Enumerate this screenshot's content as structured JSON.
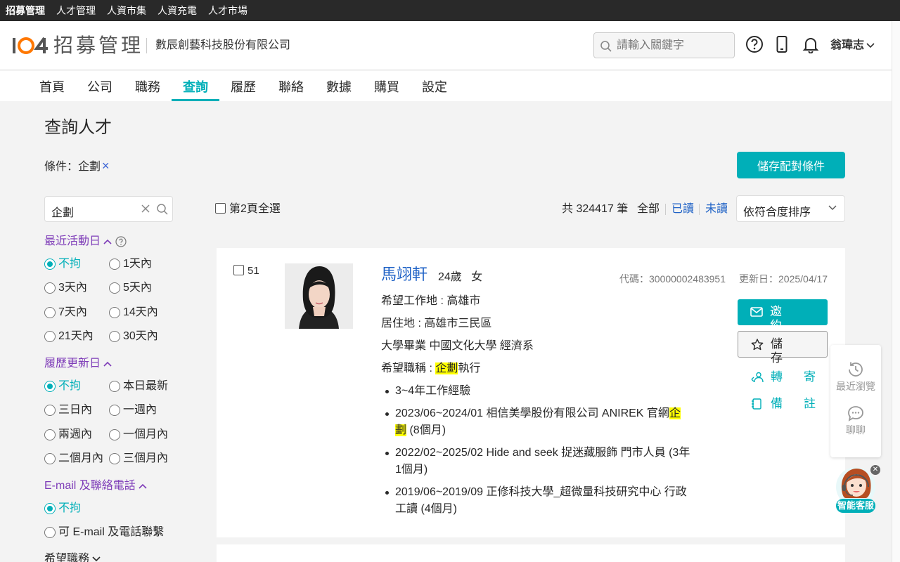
{
  "topbar": {
    "items": [
      "招募管理",
      "人才管理",
      "人資市集",
      "人資充電",
      "人才市場"
    ]
  },
  "header": {
    "brand": "招募管理",
    "company": "數辰創藝科技股份有限公司",
    "search_placeholder": "請輸入關鍵字",
    "user": "翁瑋志"
  },
  "nav": {
    "tabs": [
      "首頁",
      "公司",
      "職務",
      "查詢",
      "履歷",
      "聯絡",
      "數據",
      "購買",
      "設定"
    ],
    "active": "查詢"
  },
  "page": {
    "title": "查詢人才",
    "condition_label": "條件：企劃",
    "condition_remove": "×",
    "save_button": "儲存配對條件"
  },
  "sidebar": {
    "keyword": "企劃",
    "filters": [
      {
        "title": "最近活動日",
        "options": [
          "不拘",
          "1天內",
          "3天內",
          "5天內",
          "7天內",
          "14天內",
          "21天內",
          "30天內"
        ],
        "selected": "不拘"
      },
      {
        "title": "履歷更新日",
        "options": [
          "不拘",
          "本日最新",
          "三日內",
          "一週內",
          "兩週內",
          "一個月內",
          "二個月內",
          "三個月內"
        ],
        "selected": "不拘"
      },
      {
        "title": "E-mail 及聯絡電話",
        "options": [
          "不拘",
          "可 E-mail 及電話聯繫"
        ],
        "selected": "不拘"
      },
      {
        "title": "希望職務"
      }
    ]
  },
  "list": {
    "select_all": "第2頁全選",
    "total": "共 324417 筆",
    "filter_all": "全部",
    "filter_read": "已讀",
    "filter_unread": "未讀",
    "sort": "依符合度排序"
  },
  "card": {
    "index": "51",
    "name": "馬翊軒",
    "age": "24歲",
    "gender": "女",
    "code": "代碼：30000002483951",
    "updated": "更新日：2025/04/17",
    "wish_location": "希望工作地 : 高雄市",
    "residence": "居住地 : 高雄市三民區",
    "education": "大學畢業 中國文化大學 經濟系",
    "title_prefix": "希望職稱 : ",
    "title_hl": "企劃",
    "title_suffix": "執行",
    "experience": "3~4年工作經驗",
    "job1_a": "2023/06~2024/01 相信美學股份有限公司 ANIREK 官網",
    "job1_hl1": "企",
    "job1_hl2": "劃",
    "job1_b": " (8個月)",
    "job2_a": "2022/02~2025/02 Hide and seek 捉迷藏服飾 門市人員 (3年",
    "job2_b": "1個月)",
    "job3_a": "2019/06~2019/09 正修科技大學_超微量科技研究中心 行政",
    "job3_b": "工讀 (4個月)",
    "invite": "邀約",
    "save": "儲存",
    "forward": "轉寄",
    "note": "備註"
  },
  "float_panel": {
    "recent": "最近瀏覽",
    "chat": "聊聊",
    "bot": "智能客服"
  },
  "colors": {
    "accent": "#00afb8",
    "link": "#1f62c6",
    "filter_title": "#7e3cb8",
    "highlight": "#ffff00"
  }
}
